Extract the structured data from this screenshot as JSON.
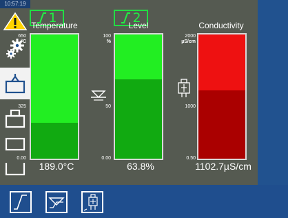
{
  "header": {
    "channel1": {
      "label": "1",
      "icon": "integral-curve-icon"
    },
    "channel2": {
      "label": "2",
      "icon": "integral-curve-icon"
    }
  },
  "panels": [
    {
      "title": "Temperature",
      "max": "650",
      "unit": "°C",
      "mid": "325",
      "min": "0.00",
      "value": "189.0°C",
      "level": 0.29,
      "color_light": "#22ee22",
      "color_dark": "#11aa11",
      "icon": "temperature-curve-icon"
    },
    {
      "title": "Level",
      "max": "100",
      "unit": "%",
      "mid": "50",
      "min": "0.00",
      "value": "63.8%",
      "level": 0.638,
      "color_light": "#22ee22",
      "color_dark": "#11aa11",
      "icon": "level-icon"
    },
    {
      "title": "Conductivity",
      "max": "2000",
      "unit": "µS/cm",
      "mid": "1000",
      "min": "0.50",
      "value": "1102.7µS/cm",
      "level": 0.551,
      "color_light": "#ee1111",
      "color_dark": "#aa0000",
      "icon": "conductivity-probe-icon"
    }
  ],
  "right_bar": {
    "time": "10:57:19",
    "items": [
      "warning-icon",
      "settings-gears-icon",
      "tray-full-icon",
      "tray-top-icon",
      "tray-middle-icon",
      "tray-bottom-icon"
    ]
  },
  "bottom_bar": {
    "items": [
      "curve-view-icon",
      "level-view-icon",
      "probe-view-icon"
    ]
  },
  "colors": {
    "main_bg": "#555a51",
    "nav_blue": "#21528f",
    "green": "#22ee22",
    "red": "#ee1111"
  }
}
